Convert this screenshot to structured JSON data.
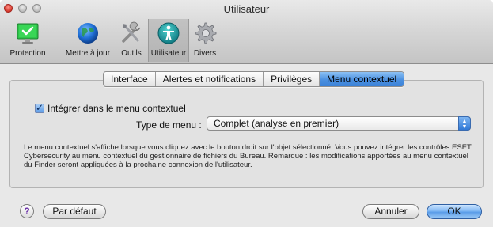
{
  "window": {
    "title": "Utilisateur"
  },
  "toolbar": {
    "items": [
      {
        "label": "Protection",
        "icon": "monitor-check-icon"
      },
      {
        "label": "Mettre à jour",
        "icon": "globe-icon"
      },
      {
        "label": "Outils",
        "icon": "tools-icon"
      },
      {
        "label": "Utilisateur",
        "icon": "user-icon",
        "selected": true
      },
      {
        "label": "Divers",
        "icon": "gear-icon"
      }
    ]
  },
  "tabs": [
    {
      "label": "Interface"
    },
    {
      "label": "Alertes et notifications"
    },
    {
      "label": "Privilèges"
    },
    {
      "label": "Menu contextuel",
      "active": true
    }
  ],
  "form": {
    "integrate_checkbox": {
      "label": "Intégrer dans le menu contextuel",
      "checked": true,
      "mark": "✓"
    },
    "menu_type": {
      "label": "Type de menu :",
      "value": "Complet (analyse en premier)"
    },
    "description": "Le menu contextuel s'affiche lorsque vous cliquez avec le bouton droit sur l'objet sélectionné. Vous pouvez intégrer les contrôles ESET Cybersecurity au menu contextuel du gestionnaire de fichiers du Bureau. Remarque : les modifications apportées au menu contextuel du Finder seront appliquées à la prochaine connexion de l'utilisateur."
  },
  "footer": {
    "help": "?",
    "default_label": "Par défaut",
    "cancel_label": "Annuler",
    "ok_label": "OK"
  },
  "colors": {
    "accent": "#4b90e0",
    "protection_green": "#2ec44a",
    "globe_blue": "#1f6fd6",
    "user_teal": "#1a9fa0"
  }
}
